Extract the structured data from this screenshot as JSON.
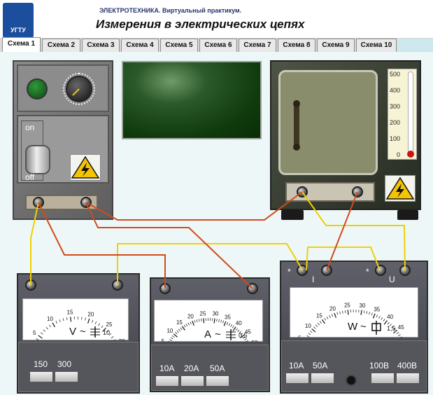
{
  "header": {
    "logo_text": "УГТУ",
    "subtitle": "ЭЛЕКТРОТЕХНИКА. Виртуальный практикум.",
    "title": "Измерения в электрических цепях"
  },
  "tabs": [
    "Схема 1",
    "Схема 2",
    "Схема 3",
    "Схема 4",
    "Схема 5",
    "Схема 6",
    "Схема 7",
    "Схема 8",
    "Схема 9",
    "Схема 10"
  ],
  "active_tab": "Схема 1",
  "power_panel": {
    "switch_on_label": "on",
    "switch_off_label": "off"
  },
  "thermometer": {
    "ticks": [
      "500",
      "400",
      "300",
      "200",
      "100",
      "0"
    ]
  },
  "voltmeter": {
    "symbol": "V",
    "class_mark": "~",
    "accuracy": "10",
    "scale": [
      "0",
      "5",
      "10",
      "15",
      "20",
      "25",
      "30"
    ],
    "ranges": [
      "150",
      "300"
    ]
  },
  "ammeter": {
    "symbol": "A",
    "class_mark": "~",
    "accuracy": "0,5",
    "scale": [
      "0",
      "5",
      "10",
      "15",
      "20",
      "25",
      "30",
      "35",
      "40",
      "45",
      "50"
    ],
    "ranges": [
      "10A",
      "20A",
      "50A"
    ]
  },
  "wattmeter": {
    "symbol": "W",
    "class_mark": "~",
    "accuracy": "1,5",
    "term_i": "I",
    "term_u": "U",
    "star": "*",
    "scale": [
      "0",
      "5",
      "10",
      "15",
      "20",
      "25",
      "30",
      "35",
      "40",
      "45",
      "50"
    ],
    "current_ranges": [
      "10A",
      "50A"
    ],
    "voltage_ranges": [
      "100B",
      "400B"
    ]
  },
  "colors": {
    "wire_red": "#d24a1c",
    "wire_yellow": "#f0d000",
    "logo_blue": "#1b4f9e"
  }
}
